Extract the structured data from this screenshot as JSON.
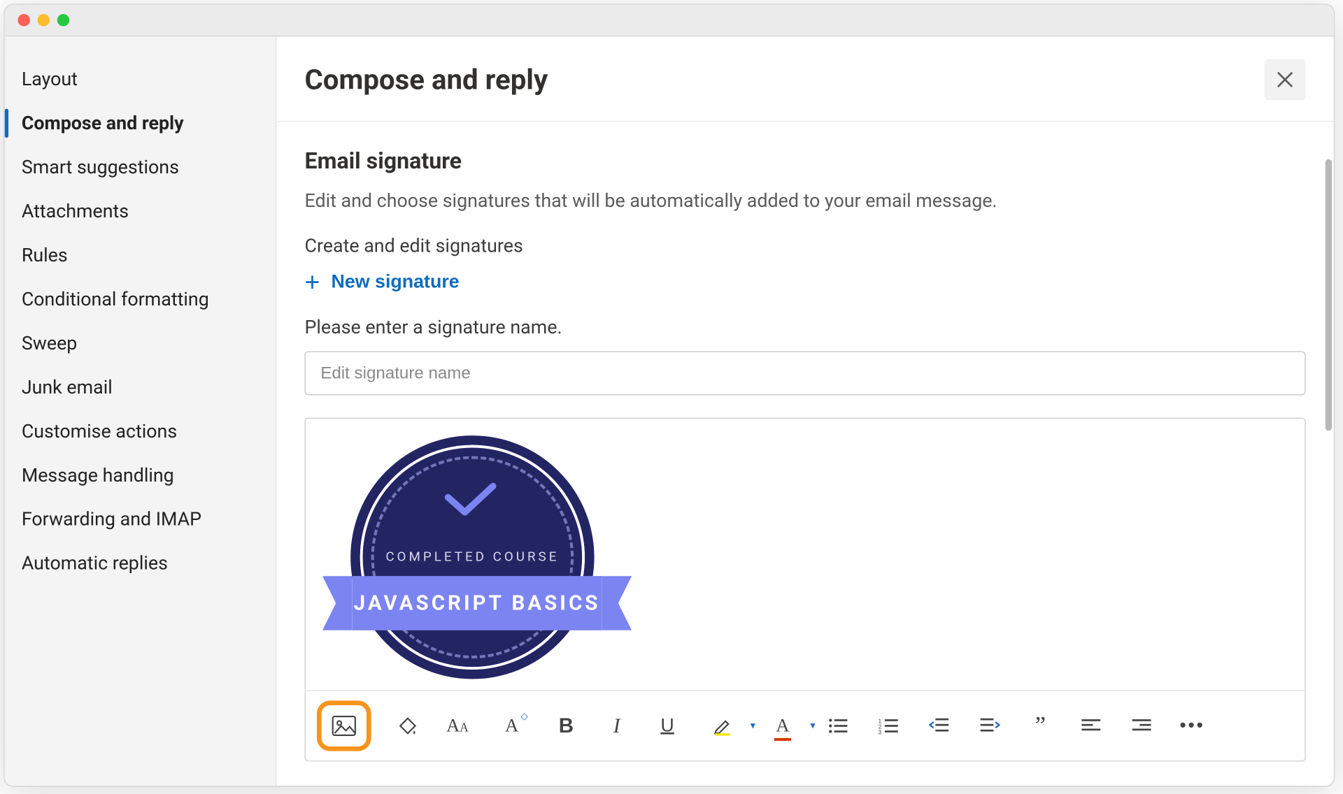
{
  "sidebar": {
    "items": [
      {
        "label": "Layout",
        "selected": false
      },
      {
        "label": "Compose and reply",
        "selected": true
      },
      {
        "label": "Smart suggestions",
        "selected": false
      },
      {
        "label": "Attachments",
        "selected": false
      },
      {
        "label": "Rules",
        "selected": false
      },
      {
        "label": "Conditional formatting",
        "selected": false
      },
      {
        "label": "Sweep",
        "selected": false
      },
      {
        "label": "Junk email",
        "selected": false
      },
      {
        "label": "Customise actions",
        "selected": false
      },
      {
        "label": "Message handling",
        "selected": false
      },
      {
        "label": "Forwarding and IMAP",
        "selected": false
      },
      {
        "label": "Automatic replies",
        "selected": false
      }
    ]
  },
  "header": {
    "title": "Compose and reply"
  },
  "signature": {
    "section_heading": "Email signature",
    "description": "Edit and choose signatures that will be automatically added to your email message.",
    "create_label": "Create and edit signatures",
    "new_button": "New signature",
    "name_prompt": "Please enter a signature name.",
    "name_placeholder": "Edit signature name"
  },
  "badge": {
    "top_text": "COMPLETED COURSE",
    "ribbon_text": "JAVASCRIPT BASICS"
  },
  "toolbar": {
    "items": [
      {
        "name": "insert-image",
        "highlight": true
      },
      {
        "name": "format-painter",
        "highlight": false
      },
      {
        "name": "font-family",
        "highlight": false
      },
      {
        "name": "font-size",
        "highlight": false
      },
      {
        "name": "bold",
        "highlight": false
      },
      {
        "name": "italic",
        "highlight": false
      },
      {
        "name": "underline",
        "highlight": false
      },
      {
        "name": "highlight-color",
        "highlight": false,
        "dropdown": true
      },
      {
        "name": "font-color",
        "highlight": false,
        "dropdown": true
      },
      {
        "name": "bulleted-list",
        "highlight": false
      },
      {
        "name": "numbered-list",
        "highlight": false
      },
      {
        "name": "outdent",
        "highlight": false
      },
      {
        "name": "indent",
        "highlight": false
      },
      {
        "name": "quote",
        "highlight": false
      },
      {
        "name": "align-left",
        "highlight": false
      },
      {
        "name": "align-right",
        "highlight": false
      },
      {
        "name": "more-options",
        "highlight": false
      }
    ]
  }
}
